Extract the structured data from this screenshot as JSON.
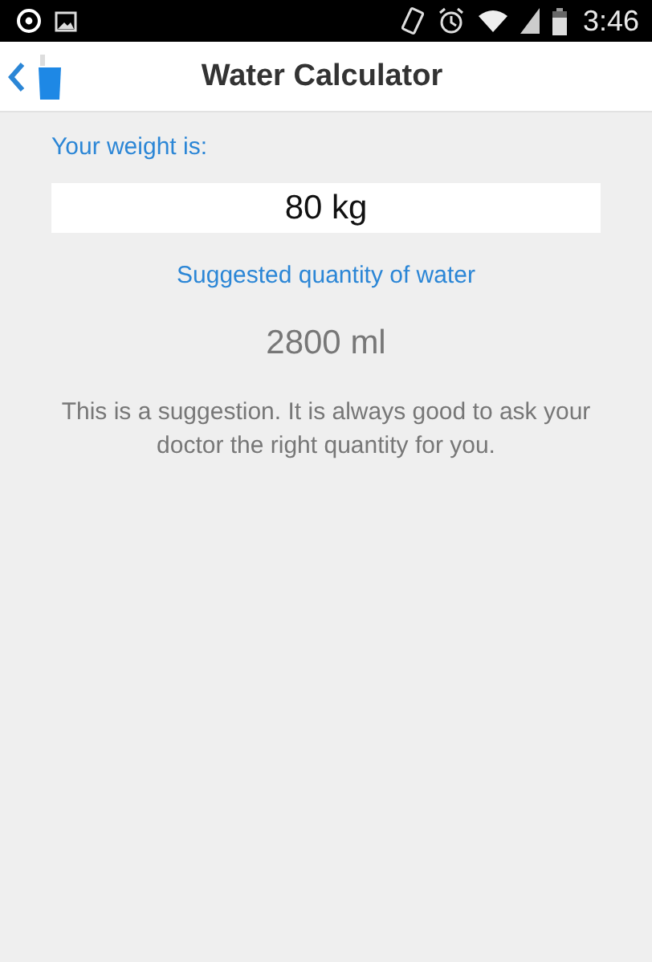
{
  "status_bar": {
    "time": "3:46"
  },
  "header": {
    "title": "Water Calculator"
  },
  "weight": {
    "label": "Your weight is:",
    "value": "80 kg"
  },
  "result": {
    "label": "Suggested quantity of water",
    "value": "2800 ml"
  },
  "disclaimer": "This is a suggestion. It is always good to ask your doctor the right quantity for you."
}
